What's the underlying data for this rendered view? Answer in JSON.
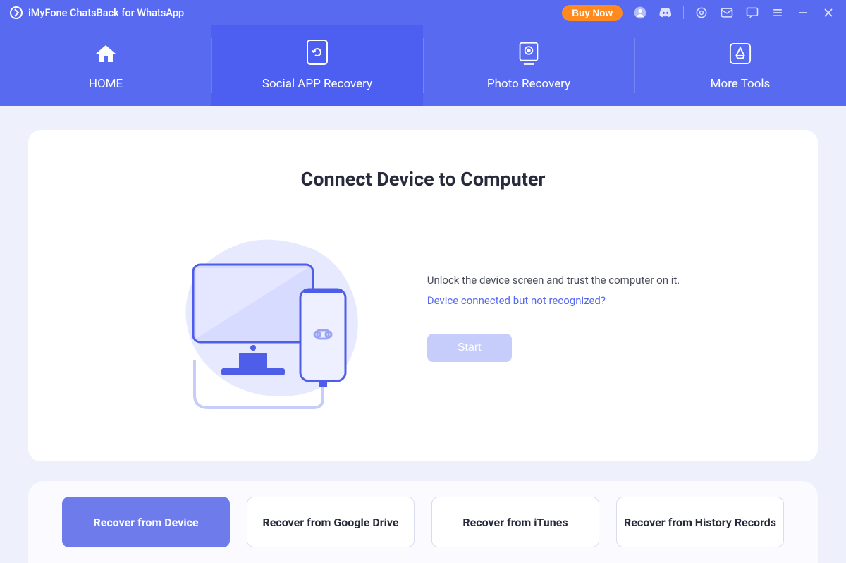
{
  "titlebar": {
    "app_title": "iMyFone ChatsBack for WhatsApp",
    "buy_now_label": "Buy Now"
  },
  "nav": {
    "items": [
      {
        "label": "HOME",
        "icon": "home-icon"
      },
      {
        "label": "Social APP Recovery",
        "icon": "refresh-icon"
      },
      {
        "label": "Photo Recovery",
        "icon": "photo-icon"
      },
      {
        "label": "More Tools",
        "icon": "appstore-icon"
      }
    ],
    "active_index": 1
  },
  "main": {
    "title": "Connect Device to Computer",
    "instruction": "Unlock the device screen and trust the computer on it.",
    "help_link_text": "Device connected but not recognized?",
    "start_label": "Start"
  },
  "bottom_tabs": {
    "items": [
      {
        "label": "Recover from Device"
      },
      {
        "label": "Recover from Google Drive"
      },
      {
        "label": "Recover from iTunes"
      },
      {
        "label": "Recover from History Records"
      }
    ],
    "active_index": 0
  },
  "colors": {
    "primary": "#576af0",
    "primary_dark": "#4d5ff0",
    "accent_orange": "#ff8a1f",
    "disabled_btn": "#c7cdfa",
    "tab_active": "#6d7cea"
  }
}
